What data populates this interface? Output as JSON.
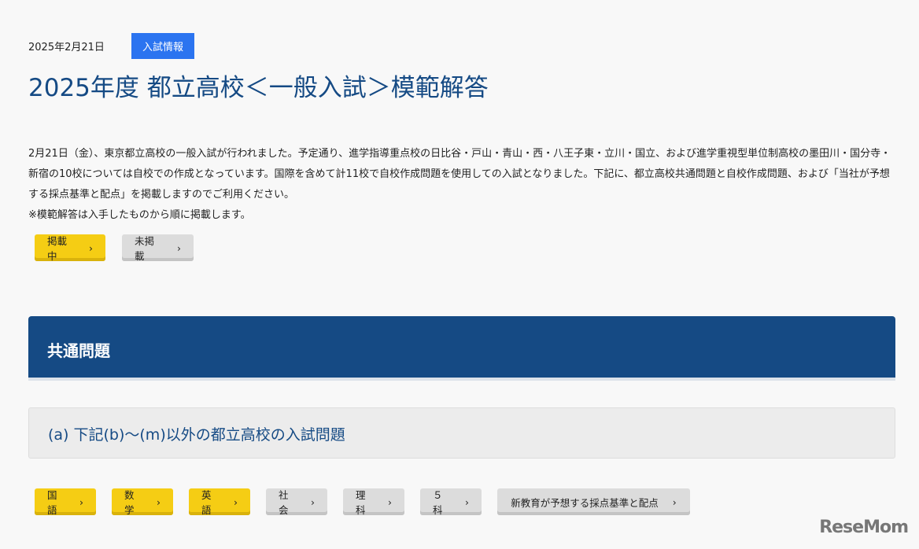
{
  "header": {
    "date": "2025年2月21日",
    "tag": "入試情報",
    "title": "2025年度 都立高校＜一般入試＞模範解答"
  },
  "intro": {
    "paragraph": "2月21日（金）、東京都立高校の一般入試が行われました。予定通り、進学指導重点校の日比谷・戸山・青山・西・八王子東・立川・国立、および進学重視型単位制高校の墨田川・国分寺・新宿の10校については自校での作成となっています。国際を含めて計11校で自校作成問題を使用しての入試となりました。下記に、都立高校共通問題と自校作成問題、および「当社が予想する採点基準と配点」を掲載しますのでご利用ください。",
    "note": "※模範解答は入手したものから順に掲載します。"
  },
  "legend": [
    {
      "label": "掲載中"
    },
    {
      "label": "未掲載"
    }
  ],
  "section": {
    "title": "共通問題",
    "subtitle": "(a) 下記(b)～(m)以外の都立高校の入試問題"
  },
  "subjects": [
    {
      "label": "国語",
      "posted": true
    },
    {
      "label": "数学",
      "posted": true
    },
    {
      "label": "英語",
      "posted": true
    },
    {
      "label": "社会",
      "posted": false
    },
    {
      "label": "理科",
      "posted": false
    },
    {
      "label": "５科",
      "posted": false
    },
    {
      "label": "新教育が予想する採点基準と配点",
      "posted": false
    }
  ],
  "chevron": "›",
  "logo": "ReseMom"
}
